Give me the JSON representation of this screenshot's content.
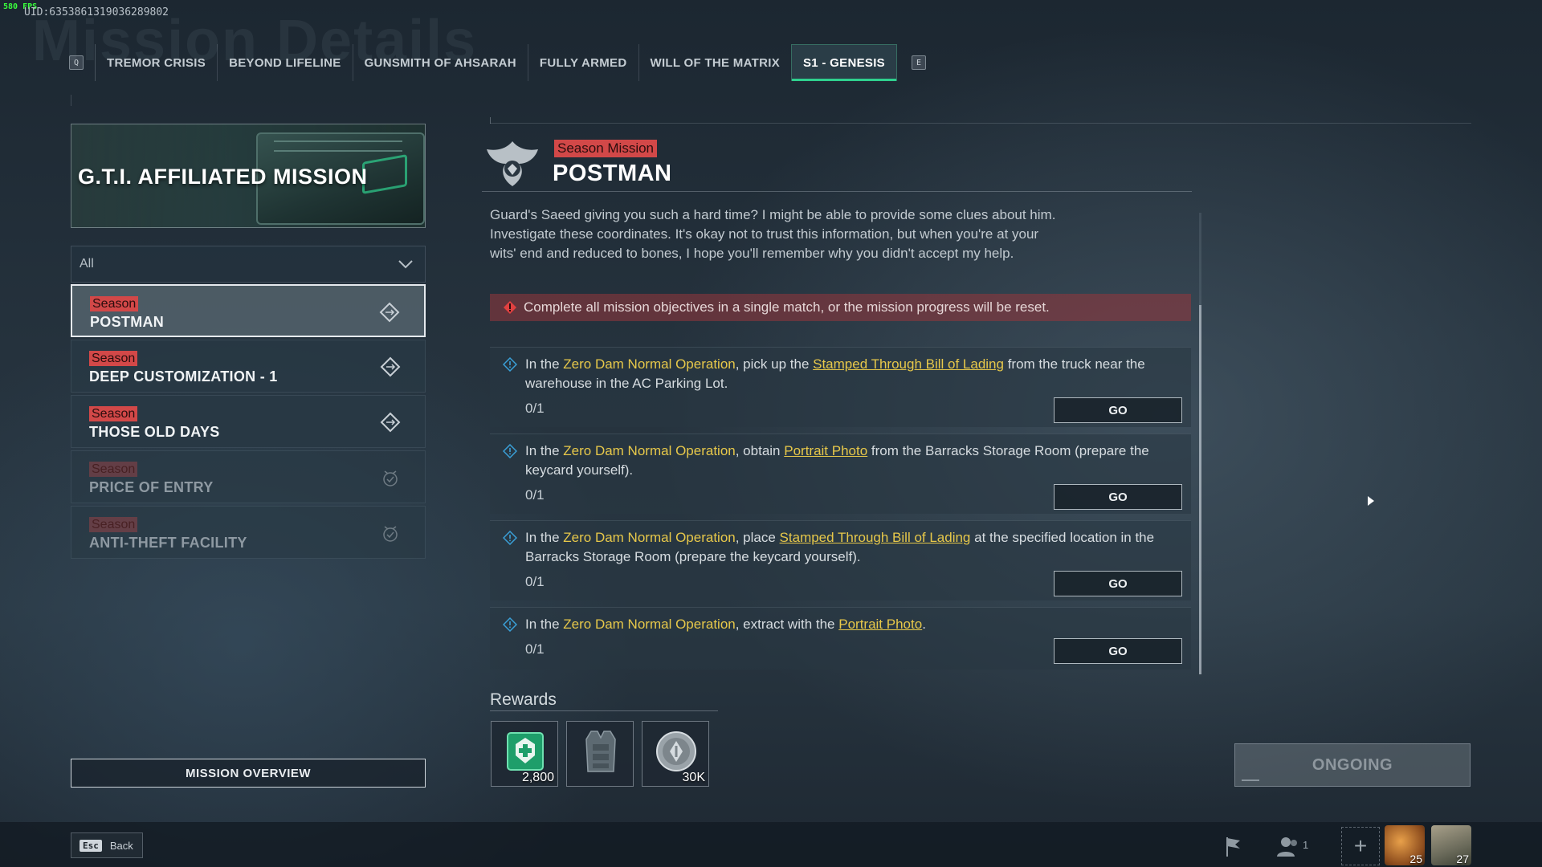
{
  "hud": {
    "fps": "580 FPS",
    "uid": "UID:6353861319036289802"
  },
  "page": {
    "ghost_title": "Mission Details"
  },
  "tabs": {
    "prev_key": "Q",
    "next_key": "E",
    "items": [
      {
        "label": "TREMOR CRISIS",
        "active": false
      },
      {
        "label": "BEYOND LIFELINE",
        "active": false
      },
      {
        "label": "GUNSMITH OF AHSARAH",
        "active": false
      },
      {
        "label": "FULLY ARMED",
        "active": false
      },
      {
        "label": "WILL OF THE MATRIX",
        "active": false
      },
      {
        "label": "S1 - GENESIS",
        "active": true
      }
    ]
  },
  "sidebar": {
    "banner_title": "G.T.I. AFFILIATED MISSION",
    "filter_value": "All",
    "missions": [
      {
        "tag": "Season",
        "name": "POSTMAN",
        "state": "selected"
      },
      {
        "tag": "Season",
        "name": "DEEP CUSTOMIZATION - 1",
        "state": "available"
      },
      {
        "tag": "Season",
        "name": "THOSE OLD DAYS",
        "state": "available"
      },
      {
        "tag": "Season",
        "name": "PRICE OF ENTRY",
        "state": "completed"
      },
      {
        "tag": "Season",
        "name": "ANTI-THEFT FACILITY",
        "state": "completed"
      }
    ],
    "overview_label": "MISSION OVERVIEW"
  },
  "detail": {
    "tag": "Season Mission",
    "title": "POSTMAN",
    "description": "Guard's Saeed giving you such a hard time? I might be able to provide some clues about him. Investigate these coordinates. It's okay not to trust this information, but when you're at your wits' end and reduced to bones, I hope you'll remember why you didn't accept my help.",
    "warning": "Complete all mission objectives in a single match, or the mission progress will be reset.",
    "objectives": [
      {
        "pre": "In the ",
        "map": "Zero Dam Normal Operation",
        "mid": ", pick up the ",
        "item": "Stamped Through Bill of Lading",
        "post": " from the truck near the warehouse in the AC Parking Lot.",
        "progress": "0/1",
        "go": "GO"
      },
      {
        "pre": "In the ",
        "map": "Zero Dam Normal Operation",
        "mid": ", obtain ",
        "item": "Portrait Photo",
        "post": " from the Barracks Storage Room (prepare the keycard yourself).",
        "progress": "0/1",
        "go": "GO"
      },
      {
        "pre": "In the ",
        "map": "Zero Dam Normal Operation",
        "mid": ", place ",
        "item": "Stamped Through Bill of Lading",
        "post": " at the specified location in the Barracks Storage Room (prepare the keycard yourself).",
        "progress": "0/1",
        "go": "GO"
      },
      {
        "pre": "In the ",
        "map": "Zero Dam Normal Operation",
        "mid": ", extract with the ",
        "item": "Portrait Photo",
        "post": ".",
        "progress": "0/1",
        "go": "GO"
      }
    ],
    "rewards_label": "Rewards",
    "rewards": [
      {
        "icon": "medkit-token-icon",
        "value": "2,800"
      },
      {
        "icon": "armor-vest-icon",
        "value": ""
      },
      {
        "icon": "silver-coin-icon",
        "value": "30K"
      }
    ],
    "status_button": "ONGOING"
  },
  "bottom": {
    "back_key": "Esc",
    "back_label": "Back",
    "friends_count": "1",
    "avatars": [
      {
        "level": "25"
      },
      {
        "level": "27"
      }
    ]
  },
  "colors": {
    "accent": "#2fd08e",
    "season_red": "#d24848",
    "highlight": "#e7c84a"
  }
}
